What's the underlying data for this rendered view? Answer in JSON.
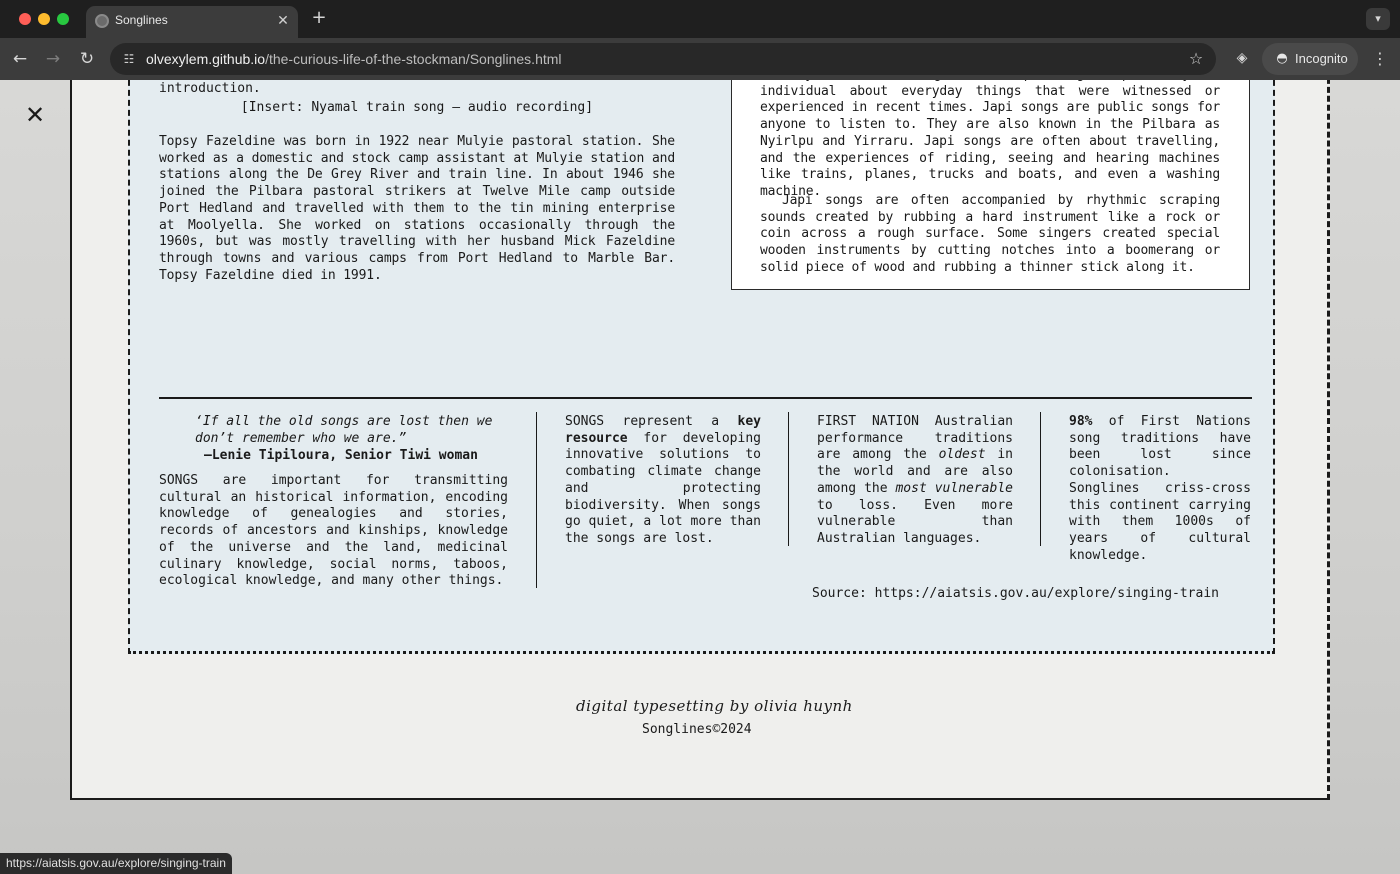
{
  "browser": {
    "tab_title": "Songlines",
    "url_host": "olvexylem.github.io",
    "url_path": "/the-curious-life-of-the-stockman/Songlines.html",
    "incognito_label": "Incognito",
    "status_url": "https://aiatsis.gov.au/explore/singing-train"
  },
  "article": {
    "intro_tail": "be made public. Listen to the train song and Basil's introduction.",
    "insert": "[Insert: Nyamal train song – audio recording]",
    "bio": "Topsy Fazeldine was born in 1922 near Mulyie pastoral station. She worked as a domestic and stock camp assistant at Mulyie station and stations along the De Grey River and train line. In about 1946 she joined the Pilbara pastoral strikers at Twelve Mile camp outside Port Hedland and travelled with them to the tin mining enterprise at Moolyella. She worked on stations occasionally through the 1960s, but was mostly travelling with her husband Mick Fazeldine through towns and various camps from Port Hedland to Marble Bar. Topsy Fazeldine died in 1991.",
    "note_p1": "The Nyamal train song is a Japi song composed by an individual about everyday things that were witnessed or experienced in recent times. Japi songs are public songs for anyone to listen to. They are also known in the Pilbara as Nyirlpu and Yirraru. Japi songs are often about travelling, and the experiences of riding, seeing and hearing machines like trains, planes, trucks and boats, and even a washing machine.",
    "note_p2": "Japi songs are often accompanied by rhythmic scraping sounds created by rubbing a hard instrument like a rock or coin across a rough surface. Some singers created special wooden instruments by cutting notches into a boomerang or solid piece of wood and rubbing a thinner stick along it."
  },
  "facts": {
    "quote": "‘If all the old songs are lost then we don’t remember who we are.”",
    "attribution": "—Lenie Tipiloura, Senior Tiwi woman",
    "col1": "SONGS are important for transmitting cultural an historical information, encoding knowledge of genealogies and stories, records of ancestors and kinships, knowledge of the universe and the land, medicinal culinary knowledge, social norms, taboos, ecological knowledge, and many other things.",
    "col2_pre": "SONGS represent a ",
    "col2_bold": "key resource",
    "col2_post": " for developing innovative solutions to combating climate change and protecting biodiversity. When songs go quiet, a lot more than the songs are lost.",
    "col3_a": "FIRST NATION Australian performance traditions are among the ",
    "col3_em1": "oldest",
    "col3_b": " in the world and are also among the ",
    "col3_em2": "most vulnerable",
    "col3_c": " to loss. Even more vulnerable than Australian languages.",
    "col4_bold": "98%",
    "col4_a": " of First Nations song traditions have been lost since colonisation.",
    "col4_b": "Songlines criss-cross this continent carrying with them 1000s of years of cultural knowledge.",
    "source": "Source: https://aiatsis.gov.au/explore/singing-train"
  },
  "footer": {
    "signature": "digital typesetting by olivia huynh",
    "copyright": "Songlines©2024"
  }
}
